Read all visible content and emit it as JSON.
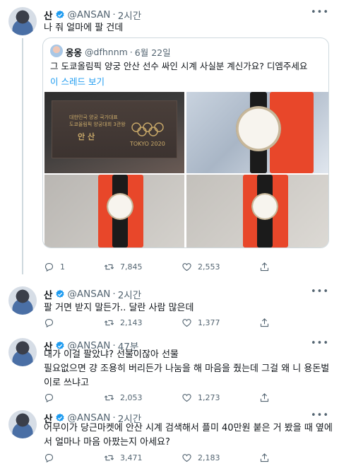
{
  "tweets": [
    {
      "name": "산",
      "handle": "@ANSAN",
      "time": "2시간",
      "text": "나 줘 얼마에 팔 건데",
      "quote": {
        "name": "옹옹",
        "handle": "@dfhnnm",
        "time": "6월 22일",
        "text": "그 도쿄올림픽 양궁 안산 선수 싸인 시계 사실분 계신가요? 디엠주세요",
        "thread_link": "이 스레드 보기",
        "box_text_1": "대한민국 양궁 국가대표",
        "box_text_2": "도쿄올림픽 양궁대회 3관왕",
        "box_signature": "안 산",
        "box_tokyo": "TOKYO 2020"
      },
      "replies": "1",
      "retweets": "7,845",
      "likes": "2,553"
    },
    {
      "name": "산",
      "handle": "@ANSAN",
      "time": "2시간",
      "text": "팔 거면 받지 말든가.. 달란 사람 많은데",
      "replies": "",
      "retweets": "2,143",
      "likes": "1,377"
    },
    {
      "name": "산",
      "handle": "@ANSAN",
      "time": "47분",
      "text_lines": [
        "내가 이걸 팔았냐? 선물이잖아 선물",
        "필요없으면 걍 조용히 버리든가 나눔을 해 마음을 줬는데 그걸 왜 니 용돈벌",
        "이로 쓰냐고"
      ],
      "replies": "",
      "retweets": "2,053",
      "likes": "1,273"
    },
    {
      "name": "산",
      "handle": "@ANSAN",
      "time": "2시간",
      "text_lines": [
        "어무이가 당근마켓에 안산 시계 검색해서 플미 40만원 붙은 거 봤을 때 옆에",
        "서 얼마나 마음 아팠는지 아세요?"
      ],
      "replies": "",
      "retweets": "3,471",
      "likes": "2,183"
    }
  ],
  "colors": {
    "accent": "#1d9bf0",
    "text": "#0f1419",
    "muted": "#536471",
    "border": "#cfd9de"
  }
}
